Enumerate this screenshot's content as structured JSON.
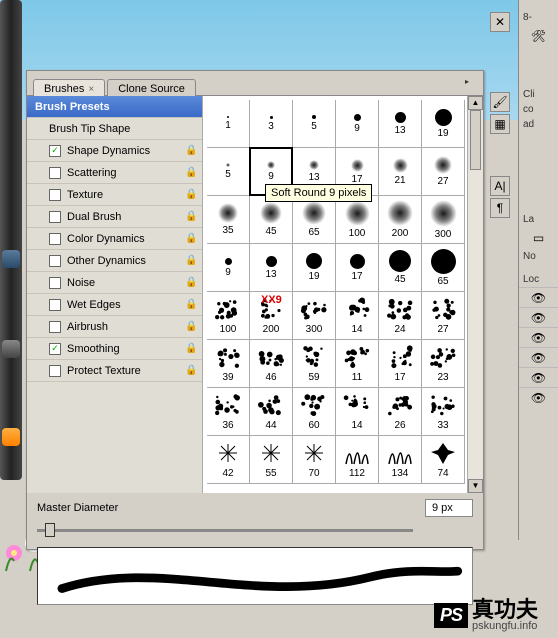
{
  "tabs": [
    {
      "label": "Brushes",
      "active": true
    },
    {
      "label": "Clone Source",
      "active": false
    }
  ],
  "sidebar": {
    "header": "Brush Presets",
    "items": [
      {
        "label": "Brush Tip Shape",
        "checkbox": false
      },
      {
        "label": "Shape Dynamics",
        "checkbox": true,
        "checked": true,
        "lock": true
      },
      {
        "label": "Scattering",
        "checkbox": true,
        "checked": false,
        "lock": true
      },
      {
        "label": "Texture",
        "checkbox": true,
        "checked": false,
        "lock": true
      },
      {
        "label": "Dual Brush",
        "checkbox": true,
        "checked": false,
        "lock": true
      },
      {
        "label": "Color Dynamics",
        "checkbox": true,
        "checked": false,
        "lock": true
      },
      {
        "label": "Other Dynamics",
        "checkbox": true,
        "checked": false,
        "lock": true
      },
      {
        "label": "Noise",
        "checkbox": true,
        "checked": false,
        "lock": true
      },
      {
        "label": "Wet Edges",
        "checkbox": true,
        "checked": false,
        "lock": true
      },
      {
        "label": "Airbrush",
        "checkbox": true,
        "checked": false,
        "lock": true
      },
      {
        "label": "Smoothing",
        "checkbox": true,
        "checked": true,
        "lock": true
      },
      {
        "label": "Protect Texture",
        "checkbox": true,
        "checked": false,
        "lock": true
      }
    ]
  },
  "brushes": [
    {
      "label": "1",
      "kind": "hard",
      "size": 2
    },
    {
      "label": "3",
      "kind": "hard",
      "size": 3
    },
    {
      "label": "5",
      "kind": "hard",
      "size": 4
    },
    {
      "label": "9",
      "kind": "hard",
      "size": 7
    },
    {
      "label": "13",
      "kind": "hard",
      "size": 11
    },
    {
      "label": "19",
      "kind": "hard",
      "size": 17
    },
    {
      "label": "5",
      "kind": "soft",
      "size": 4
    },
    {
      "label": "9",
      "kind": "soft",
      "size": 8,
      "selected": true
    },
    {
      "label": "13",
      "kind": "soft",
      "size": 10
    },
    {
      "label": "17",
      "kind": "soft",
      "size": 13
    },
    {
      "label": "21",
      "kind": "soft",
      "size": 15
    },
    {
      "label": "27",
      "kind": "soft",
      "size": 18
    },
    {
      "label": "35",
      "kind": "soft",
      "size": 20
    },
    {
      "label": "45",
      "kind": "soft",
      "size": 22
    },
    {
      "label": "65",
      "kind": "soft",
      "size": 24
    },
    {
      "label": "100",
      "kind": "soft",
      "size": 25
    },
    {
      "label": "200",
      "kind": "soft",
      "size": 26
    },
    {
      "label": "300",
      "kind": "soft",
      "size": 27
    },
    {
      "label": "9",
      "kind": "hard",
      "size": 7
    },
    {
      "label": "13",
      "kind": "hard",
      "size": 11
    },
    {
      "label": "19",
      "kind": "hard",
      "size": 16
    },
    {
      "label": "17",
      "kind": "hard",
      "size": 15
    },
    {
      "label": "45",
      "kind": "hard",
      "size": 22
    },
    {
      "label": "65",
      "kind": "hard",
      "size": 25
    },
    {
      "label": "100",
      "kind": "scatter"
    },
    {
      "label": "200",
      "kind": "scatter"
    },
    {
      "label": "300",
      "kind": "scatter"
    },
    {
      "label": "14",
      "kind": "scatter"
    },
    {
      "label": "24",
      "kind": "scatter"
    },
    {
      "label": "27",
      "kind": "scatter"
    },
    {
      "label": "39",
      "kind": "scatter"
    },
    {
      "label": "46",
      "kind": "scatter"
    },
    {
      "label": "59",
      "kind": "scatter"
    },
    {
      "label": "11",
      "kind": "scatter"
    },
    {
      "label": "17",
      "kind": "scatter"
    },
    {
      "label": "23",
      "kind": "scatter"
    },
    {
      "label": "36",
      "kind": "scatter"
    },
    {
      "label": "44",
      "kind": "scatter"
    },
    {
      "label": "60",
      "kind": "scatter"
    },
    {
      "label": "14",
      "kind": "scatter"
    },
    {
      "label": "26",
      "kind": "scatter"
    },
    {
      "label": "33",
      "kind": "scatter"
    },
    {
      "label": "42",
      "kind": "star"
    },
    {
      "label": "55",
      "kind": "star"
    },
    {
      "label": "70",
      "kind": "star"
    },
    {
      "label": "112",
      "kind": "grass"
    },
    {
      "label": "134",
      "kind": "grass"
    },
    {
      "label": "74",
      "kind": "leaf"
    }
  ],
  "tooltip": "Soft Round 9 pixels",
  "diameter": {
    "label": "Master Diameter",
    "value": "9 px"
  },
  "rightStrip": {
    "tools": [
      "crosshair-icon",
      "history-brush-icon",
      "wrench-icon",
      "type-icon",
      "paragraph-icon"
    ]
  },
  "rightPanel": {
    "labels": [
      "8-",
      "Cli",
      "co",
      "ad",
      "La",
      "No",
      "Loc"
    ],
    "eyes": 6
  },
  "overlayText": "XX9",
  "watermark": {
    "logo": "PS",
    "title": "真功夫",
    "sub": "pskungfu.info"
  }
}
